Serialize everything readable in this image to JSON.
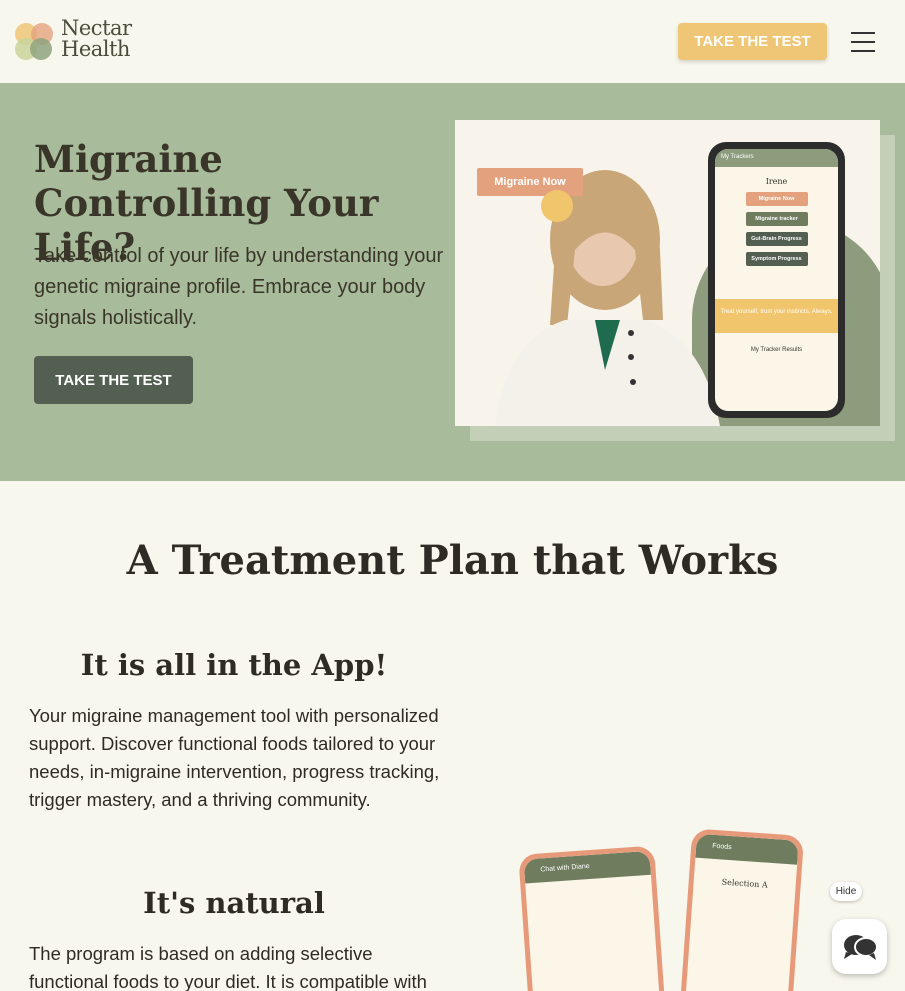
{
  "header": {
    "logo_line1": "Nectar",
    "logo_line2": "Health",
    "cta_label": "TAKE THE TEST",
    "menu_icon": "hamburger-icon"
  },
  "hero": {
    "title": "Migraine Controlling Your Life?",
    "subtitle": "Take control of your life by understanding your genetic migraine profile. Embrace your body signals holistically.",
    "cta_label": "TAKE THE TEST",
    "badge": "Migraine Now",
    "phone": {
      "header": "My Trackers",
      "name": "Irene",
      "buttons": [
        "Migraine Now",
        "Migraine tracker",
        "Gut-Brain Progress",
        "Symptom Progress"
      ],
      "banner": "Treat yourself, trust your instincts, Always.",
      "results": "My Tracker Results"
    }
  },
  "section": {
    "title": "A Treatment Plan that Works",
    "block1_title": "It is all in the App!",
    "block1_text": "Your migraine management tool with personalized support. Discover functional foods tailored to your needs, in-migraine intervention, progress tracking, trigger mastery, and a thriving community.",
    "block2_title": "It's natural",
    "block2_text": "The program is based on adding selective functional foods to your diet. It is compatible with",
    "phone_left_header": "Chat with Diane",
    "phone_right_header": "Foods",
    "phone_right_sub": "Selection A"
  },
  "widget": {
    "hide_label": "Hide",
    "chat_icon": "chat-bubbles-icon"
  },
  "colors": {
    "background": "#f8f7ed",
    "hero_bg": "#a8bc9c",
    "accent_yellow": "#eec675",
    "dark_button": "#525f51",
    "salmon": "#e3a27d"
  }
}
